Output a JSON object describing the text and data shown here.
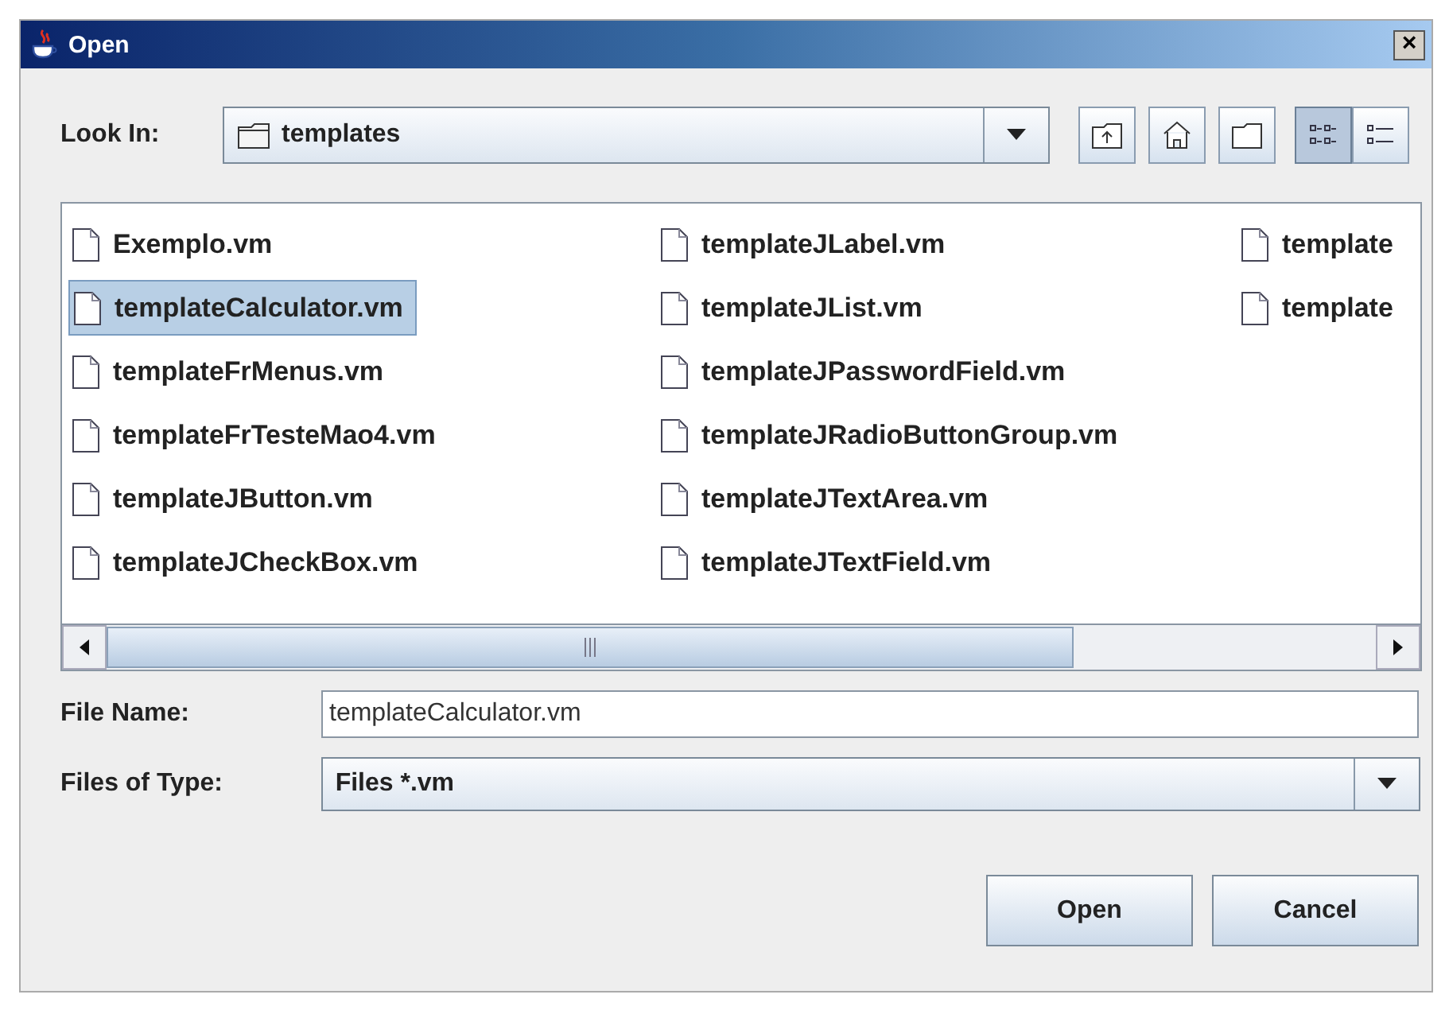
{
  "window": {
    "title": "Open",
    "close": "×"
  },
  "look_in": {
    "label": "Look In:",
    "value": "templates"
  },
  "toolbar": [
    {
      "kind": "up",
      "selected": false
    },
    {
      "kind": "home",
      "selected": false
    },
    {
      "kind": "newfolder",
      "selected": false
    },
    {
      "kind": "list",
      "selected": true
    },
    {
      "kind": "details",
      "selected": false
    }
  ],
  "files": [
    [
      {
        "name": "Exemplo.vm",
        "selected": false
      },
      {
        "name": "templateCalculator.vm",
        "selected": true
      },
      {
        "name": "templateFrMenus.vm",
        "selected": false
      },
      {
        "name": "templateFrTesteMao4.vm",
        "selected": false
      },
      {
        "name": "templateJButton.vm",
        "selected": false
      },
      {
        "name": "templateJCheckBox.vm",
        "selected": false
      }
    ],
    [
      {
        "name": "templateJLabel.vm",
        "selected": false
      },
      {
        "name": "templateJList.vm",
        "selected": false
      },
      {
        "name": "templateJPasswordField.vm",
        "selected": false
      },
      {
        "name": "templateJRadioButtonGroup.vm",
        "selected": false
      },
      {
        "name": "templateJTextArea.vm",
        "selected": false
      },
      {
        "name": "templateJTextField.vm",
        "selected": false
      }
    ],
    [
      {
        "name": "template",
        "selected": false
      },
      {
        "name": "template",
        "selected": false
      }
    ]
  ],
  "file_name": {
    "label": "File Name:",
    "value": "templateCalculator.vm"
  },
  "file_type": {
    "label": "Files of Type:",
    "value": "Files *.vm"
  },
  "buttons": [
    "Open",
    "Cancel"
  ]
}
